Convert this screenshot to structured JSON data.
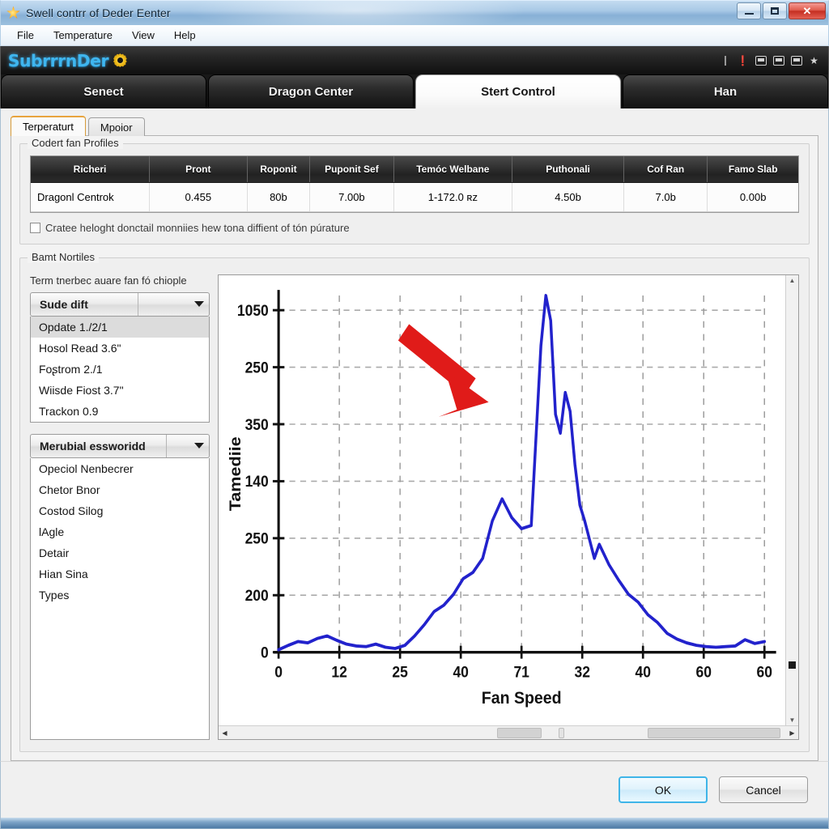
{
  "window": {
    "title": "Swell contrr of Deder Eenter",
    "icon": "app-star-icon",
    "controls": {
      "minimize": "–",
      "maximize": "❐",
      "close": "✕"
    }
  },
  "menubar": {
    "items": [
      "File",
      "Temperature",
      "View",
      "Help"
    ]
  },
  "brandbar": {
    "logo": "SubrrrnDer",
    "gear_icon": "gear-icon",
    "icons": [
      "tick-icon",
      "help-icon",
      "refresh-icon",
      "save-icon",
      "restore-icon",
      "star-icon"
    ]
  },
  "main_tabs": [
    {
      "label": "Senect",
      "active": false
    },
    {
      "label": "Dragon Center",
      "active": false
    },
    {
      "label": "Stert Control",
      "active": true
    },
    {
      "label": "Han",
      "active": false
    }
  ],
  "sub_tabs": [
    {
      "label": "Terperaturt",
      "active": true
    },
    {
      "label": "Mpoior",
      "active": false
    }
  ],
  "profiles_group": {
    "title": "Codert fan Profiles",
    "columns": [
      "Richeri",
      "Pront",
      "Roponit",
      "Puponit Sef",
      "Temóc Welbane",
      "Puthonali",
      "Cof Ran",
      "Famo Slab"
    ],
    "rows": [
      [
        "Dragonl Centrok",
        "0.455",
        "80b",
        "7.00b",
        "1-172.0 ʀz",
        "4.50b",
        "7.0b",
        "0.00b"
      ]
    ],
    "checkbox": {
      "checked": false,
      "label": "Cratee heloght donctail monniies hew tona diffient of tón púrature"
    }
  },
  "band_group": {
    "title": "Bamt Nortiles",
    "selector_label": "Term tnerbec auare fan fó chiople",
    "combo1": {
      "value": "Sude dift",
      "caret": "chevron-down-icon"
    },
    "list1": [
      {
        "label": "Opdate   1./2/1",
        "selected": true
      },
      {
        "label": "Hosol Read   3.6\"",
        "selected": false
      },
      {
        "label": "Foʂtrom   2./1",
        "selected": false
      },
      {
        "label": "Wiisde Fiost   3.7\"",
        "selected": false
      },
      {
        "label": "Trackon   0.9",
        "selected": false
      }
    ],
    "combo2": {
      "value": "Merubial essworidd",
      "caret": "chevron-down-icon"
    },
    "list2": [
      {
        "label": "Opeciol Nenbecrer",
        "selected": false
      },
      {
        "label": "Chetor Bnor",
        "selected": false
      },
      {
        "label": "Costod Silog",
        "selected": false
      },
      {
        "label": "lAgle",
        "selected": false
      },
      {
        "label": "Detair",
        "selected": false
      },
      {
        "label": "Hian Sina",
        "selected": false
      },
      {
        "label": "Types",
        "selected": false
      }
    ]
  },
  "chart_data": {
    "type": "line",
    "title": "",
    "xlabel": "Fan Speed",
    "ylabel": "Tamediie",
    "grid": true,
    "legend": false,
    "line_color": "#2222cc",
    "x_ticks": [
      0,
      12,
      25,
      40,
      71,
      32,
      40,
      60,
      60
    ],
    "y_ticks": [
      1050,
      250,
      350,
      140,
      250,
      200,
      0
    ],
    "xlim": [
      0,
      100
    ],
    "ylim": [
      0,
      1140
    ],
    "annotation": {
      "type": "arrow",
      "color": "#e01b19",
      "label": "red-arrow-annotation"
    },
    "series": [
      {
        "name": "temperature",
        "x": [
          0,
          2,
          4,
          6,
          8,
          10,
          12,
          14,
          16,
          18,
          20,
          22,
          24,
          26,
          28,
          30,
          32,
          34,
          36,
          38,
          40,
          42,
          44,
          46,
          48,
          50,
          52,
          54,
          55,
          56,
          57,
          58,
          59,
          60,
          61,
          62,
          63,
          64,
          65,
          66,
          68,
          70,
          72,
          74,
          76,
          78,
          80,
          82,
          84,
          86,
          88,
          90,
          92,
          94,
          96,
          98,
          100
        ],
        "values": [
          8,
          22,
          34,
          30,
          44,
          52,
          38,
          26,
          20,
          18,
          26,
          16,
          12,
          22,
          52,
          88,
          130,
          150,
          185,
          235,
          255,
          300,
          420,
          490,
          430,
          395,
          405,
          980,
          1140,
          1060,
          760,
          700,
          830,
          770,
          600,
          470,
          420,
          360,
          300,
          345,
          280,
          230,
          185,
          160,
          120,
          95,
          60,
          42,
          30,
          22,
          18,
          16,
          18,
          20,
          40,
          28,
          34
        ]
      }
    ]
  },
  "chart_scroll": {
    "left_arrow": "left-arrow-icon",
    "right_arrow": "right-arrow-icon",
    "up_arrow": "up-arrow-icon",
    "down_arrow": "down-arrow-icon"
  },
  "footer": {
    "ok": "OK",
    "cancel": "Cancel"
  }
}
